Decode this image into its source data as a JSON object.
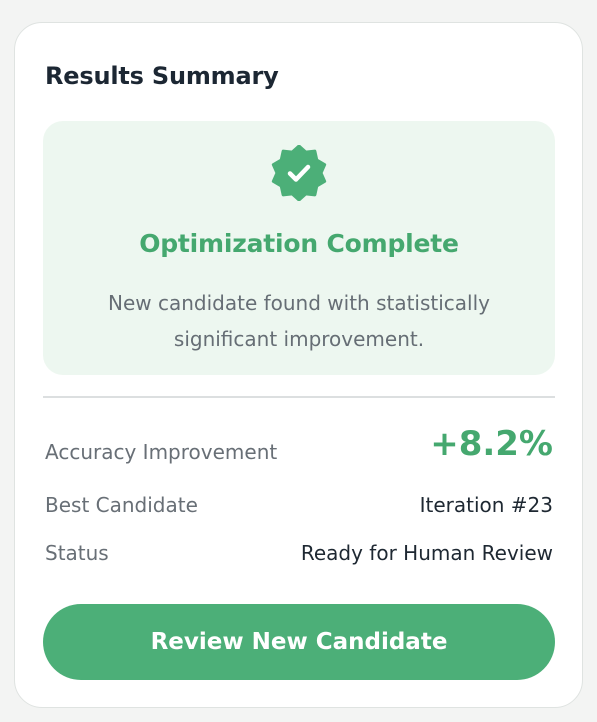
{
  "card": {
    "title": "Results Summary"
  },
  "success": {
    "icon": "verified-badge-icon",
    "heading": "Optimization Complete",
    "description": "New candidate found with statistically significant improvement."
  },
  "metrics": [
    {
      "label": "Accuracy Improvement",
      "value": "+8.2%"
    },
    {
      "label": "Best Candidate",
      "value": "Iteration #23"
    },
    {
      "label": "Status",
      "value": "Ready for Human Review"
    }
  ],
  "actions": {
    "review_label": "Review New Candidate"
  },
  "colors": {
    "accent": "#4caf78",
    "accent_text": "#45a86f",
    "panel_bg": "#edf7f0"
  }
}
